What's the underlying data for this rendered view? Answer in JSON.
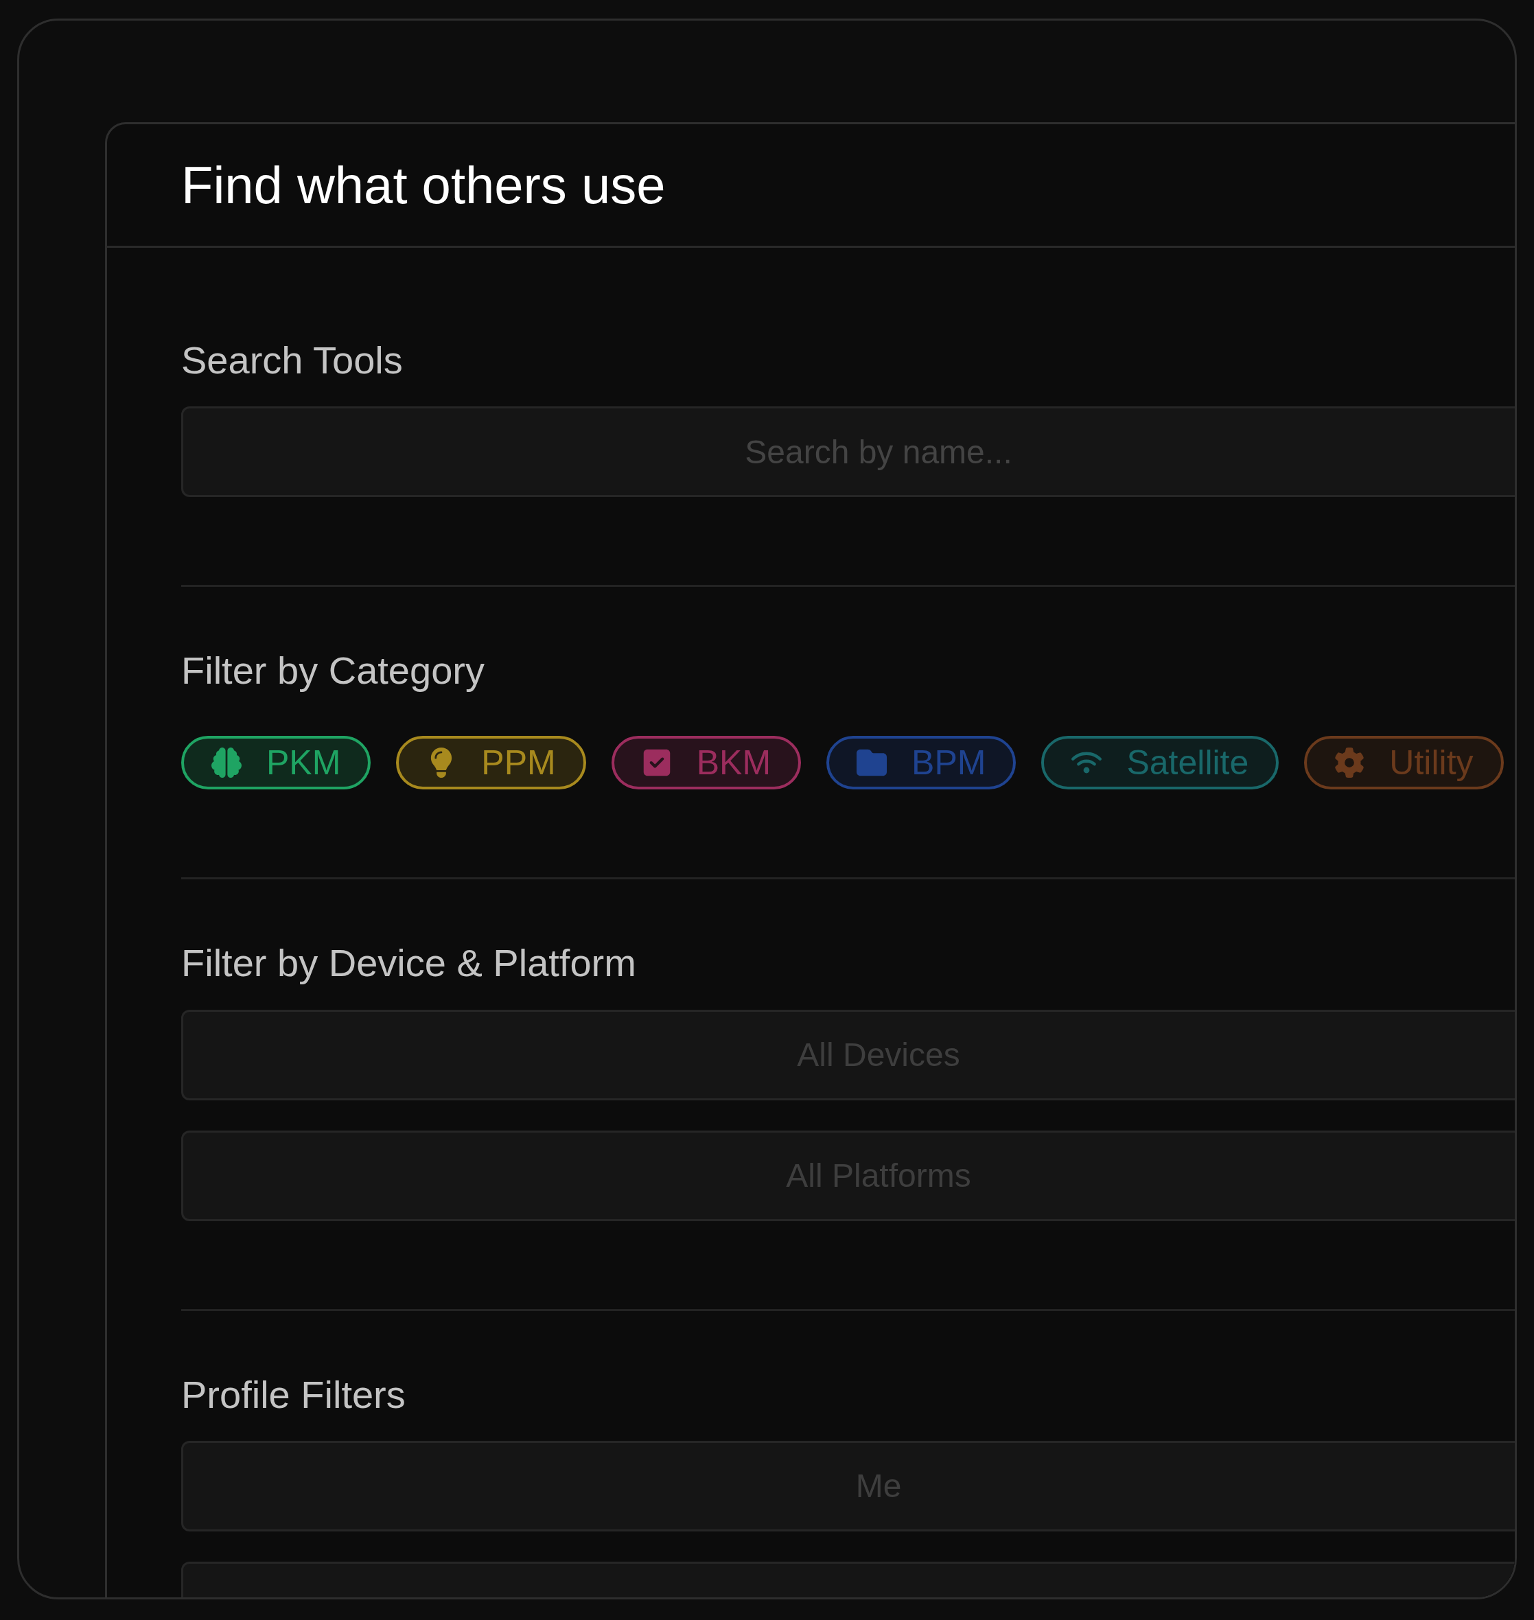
{
  "panel": {
    "title": "Find what others use"
  },
  "search": {
    "label": "Search Tools",
    "placeholder": "Search by name..."
  },
  "category_filter": {
    "label": "Filter by Category",
    "chips": [
      {
        "label": "PKM",
        "color": "#1fa463"
      },
      {
        "label": "PPM",
        "color": "#a88a1e"
      },
      {
        "label": "BKM",
        "color": "#9c2d5e"
      },
      {
        "label": "BPM",
        "color": "#1f4390"
      },
      {
        "label": "Satellite",
        "color": "#19686a"
      },
      {
        "label": "Utility",
        "color": "#6b3a1c"
      }
    ]
  },
  "device_filter": {
    "label": "Filter by Device & Platform",
    "selects": [
      {
        "value": "All Devices"
      },
      {
        "value": "All Platforms"
      }
    ]
  },
  "profile_filter": {
    "label": "Profile Filters",
    "selects": [
      {
        "value": "Me"
      }
    ]
  }
}
